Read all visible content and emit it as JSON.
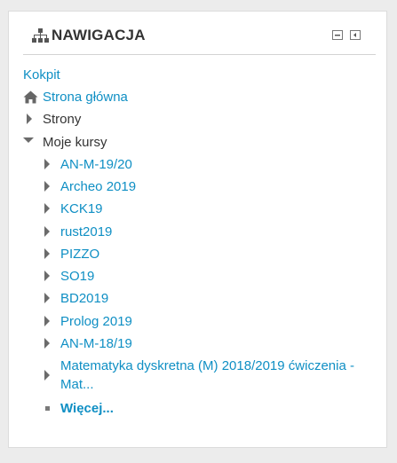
{
  "block": {
    "title": "NAWIGACJA",
    "title_icon": "sitemap-icon",
    "hide_control_icon": "minimize-icon",
    "dock_control_icon": "dock-icon"
  },
  "nav": {
    "dashboard": "Kokpit",
    "home": "Strona główna",
    "home_icon": "home-icon",
    "pages": "Strony",
    "my_courses": "Moje kursy",
    "courses": [
      "AN-M-19/20",
      "Archeo 2019",
      "KCK19",
      "rust2019",
      "PIZZO",
      "SO19",
      "BD2019",
      "Prolog 2019",
      "AN-M-18/19",
      "Matematyka dyskretna (M) 2018/2019 ćwiczenia - Mat..."
    ],
    "more": "Więcej..."
  },
  "colors": {
    "link": "#0f8fc4",
    "text": "#333333",
    "background": "#ececec"
  }
}
